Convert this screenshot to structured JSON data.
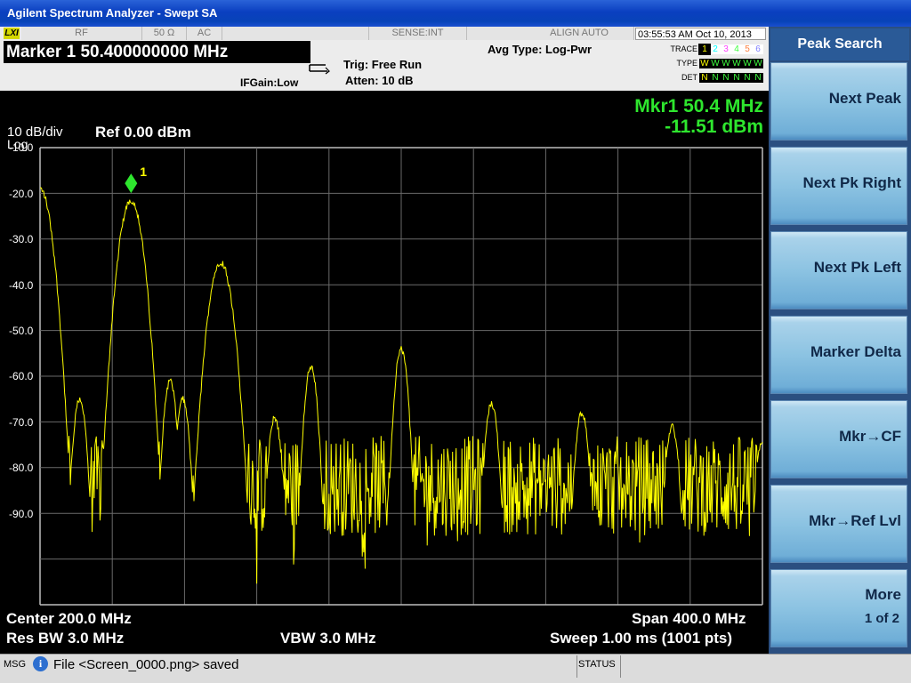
{
  "window": {
    "title": "Agilent Spectrum Analyzer - Swept SA"
  },
  "header": {
    "lxi": "LXI",
    "rf": "RF",
    "impedance": "50 Ω",
    "coupling": "AC",
    "sense": "SENSE:INT",
    "align": "ALIGN AUTO",
    "datetime": "03:55:53 AM Oct 10, 2013",
    "marker_title": "Marker 1  50.400000000 MHz",
    "ifgain": "IFGain:Low",
    "trig": "Trig: Free Run",
    "atten": "Atten: 10 dB",
    "avg_type": "Avg Type: Log-Pwr",
    "trace_label": "TRACE",
    "type_label": "TYPE",
    "det_label": "DET",
    "trace_nums": [
      "1",
      "2",
      "3",
      "4",
      "5",
      "6"
    ],
    "trace_colors": [
      "#ffff00",
      "#00ffff",
      "#ff40ff",
      "#40ff40",
      "#ff8040",
      "#8080ff"
    ],
    "type_vals": [
      "W",
      "W",
      "W",
      "W",
      "W",
      "W"
    ],
    "det_vals": [
      "N",
      "N",
      "N",
      "N",
      "N",
      "N"
    ]
  },
  "display": {
    "scale": "10 dB/div",
    "scale_type": "Log",
    "ref_level": "Ref 0.00 dBm",
    "marker_freq": "Mkr1 50.4 MHz",
    "marker_amp": "-11.51 dBm",
    "marker_label": "1",
    "y_labels": [
      "-10.0",
      "-20.0",
      "-30.0",
      "-40.0",
      "-50.0",
      "-60.0",
      "-70.0",
      "-80.0",
      "-90.0"
    ],
    "center": "Center 200.0 MHz",
    "span": "Span 400.0 MHz",
    "res_bw": "Res BW 3.0 MHz",
    "vbw": "VBW 3.0 MHz",
    "sweep": "Sweep  1.00 ms (1001 pts)",
    "trace_color": "#ffff00",
    "marker_color": "#2ee62e"
  },
  "chart_data": {
    "type": "line",
    "xlim_mhz": [
      0,
      400
    ],
    "ylim_dbm": [
      -100,
      0
    ],
    "noise_floor_dbm": -74,
    "peaks": [
      {
        "freq_mhz": 0,
        "amp_dbm": -9
      },
      {
        "freq_mhz": 22,
        "amp_dbm": -55
      },
      {
        "freq_mhz": 50.4,
        "amp_dbm": -11.51
      },
      {
        "freq_mhz": 72,
        "amp_dbm": -51
      },
      {
        "freq_mhz": 79,
        "amp_dbm": -55
      },
      {
        "freq_mhz": 100,
        "amp_dbm": -25
      },
      {
        "freq_mhz": 130,
        "amp_dbm": -59
      },
      {
        "freq_mhz": 150,
        "amp_dbm": -48
      },
      {
        "freq_mhz": 200,
        "amp_dbm": -44
      },
      {
        "freq_mhz": 250,
        "amp_dbm": -56
      },
      {
        "freq_mhz": 300,
        "amp_dbm": -58
      },
      {
        "freq_mhz": 350,
        "amp_dbm": -61
      },
      {
        "freq_mhz": 400,
        "amp_dbm": -64
      }
    ],
    "marker": {
      "freq_mhz": 50.4,
      "amp_dbm": -11.51
    }
  },
  "status": {
    "msg_label": "MSG",
    "message": "File <Screen_0000.png> saved",
    "status_label": "STATUS"
  },
  "softkeys": {
    "menu_title": "Peak Search",
    "items": [
      {
        "label": "Next Peak"
      },
      {
        "label": "Next Pk Right"
      },
      {
        "label": "Next Pk Left"
      },
      {
        "label": "Marker Delta"
      },
      {
        "label": "Mkr→CF"
      },
      {
        "label": "Mkr→Ref Lvl"
      },
      {
        "label": "More",
        "sub": "1 of 2"
      }
    ]
  }
}
